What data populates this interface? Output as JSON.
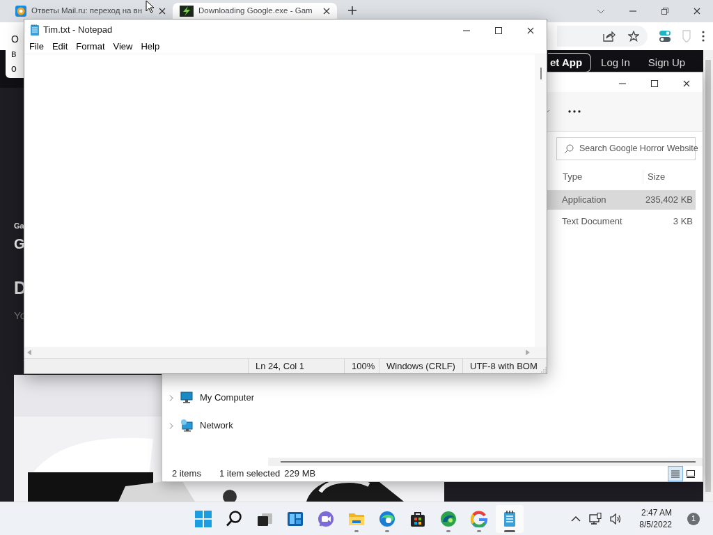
{
  "browser": {
    "tabs": [
      {
        "title": "Ответы Mail.ru: переход на вн",
        "selected": false
      },
      {
        "title": "Downloading Google.exe - Gam",
        "selected": true
      }
    ],
    "popup_lines": [
      "О",
      "в",
      "о"
    ],
    "nav_buttons": [
      {
        "label": "et App",
        "kind": "outline"
      },
      {
        "label": "Log In",
        "kind": "plain"
      },
      {
        "label": "Sign Up",
        "kind": "plain"
      }
    ],
    "hero_texts": [
      {
        "text": "Ga",
        "kind": "eyebrow"
      },
      {
        "text": "G",
        "kind": "heading"
      },
      {
        "text": "D",
        "kind": "title"
      },
      {
        "text": "Yo",
        "kind": "muted"
      }
    ]
  },
  "explorer": {
    "search_placeholder": "Search Google Horror Website",
    "columns": [
      "Type",
      "Size"
    ],
    "rows": [
      {
        "type": "Application",
        "size": "235,402 KB",
        "selected": true
      },
      {
        "type": "Text Document",
        "size": "3 KB",
        "selected": false
      }
    ],
    "nav": [
      {
        "label": "My Computer",
        "kind": "computer"
      },
      {
        "label": "Network",
        "kind": "network"
      }
    ],
    "status": {
      "count": "2 items",
      "selection": "1 item selected",
      "selection_size": "229 MB"
    },
    "views": [
      {
        "kind": "details",
        "selected": true
      },
      {
        "kind": "tiles",
        "selected": false
      }
    ]
  },
  "notepad": {
    "title": "Tim.txt - Notepad",
    "menu": [
      "File",
      "Edit",
      "Format",
      "View",
      "Help"
    ],
    "status": [
      "Ln 24, Col 1",
      "100%",
      "Windows (CRLF)",
      "UTF-8 with BOM"
    ]
  },
  "taskbar": {
    "apps": [
      {
        "kind": "start",
        "running": false,
        "selected": false
      },
      {
        "kind": "search",
        "running": false,
        "selected": false
      },
      {
        "kind": "taskview",
        "running": false,
        "selected": false
      },
      {
        "kind": "widgets",
        "running": false,
        "selected": false
      },
      {
        "kind": "chat",
        "running": false,
        "selected": false
      },
      {
        "kind": "explorer",
        "running": true,
        "selected": false
      },
      {
        "kind": "edge",
        "running": true,
        "selected": false
      },
      {
        "kind": "store",
        "running": false,
        "selected": false
      },
      {
        "kind": "swirl",
        "running": true,
        "selected": false
      },
      {
        "kind": "google",
        "running": true,
        "selected": false
      },
      {
        "kind": "notepad",
        "running": true,
        "selected": true
      }
    ],
    "time": "2:47 AM",
    "date": "8/5/2022",
    "notifications": "1"
  }
}
